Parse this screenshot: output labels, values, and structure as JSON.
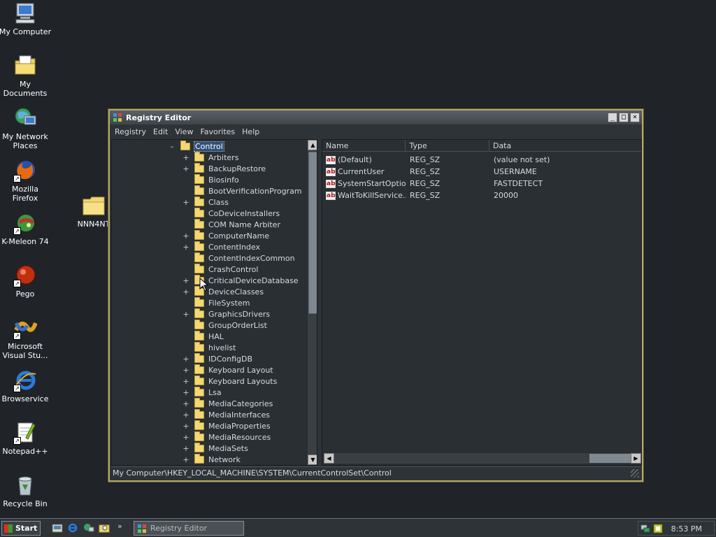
{
  "desktop": {
    "icons": [
      {
        "name": "my-computer",
        "label": "My Computer"
      },
      {
        "name": "my-documents",
        "label": "My Documents"
      },
      {
        "name": "my-network-places",
        "label": "My Network Places"
      },
      {
        "name": "mozilla-firefox",
        "label": "Mozilla Firefox"
      },
      {
        "name": "k-meleon",
        "label": "K-Meleon 74"
      },
      {
        "name": "pego",
        "label": "Pego"
      },
      {
        "name": "visual-studio",
        "label": "Microsoft Visual Stu..."
      },
      {
        "name": "browservice",
        "label": "Browservice"
      },
      {
        "name": "notepad-plus-plus",
        "label": "Notepad++"
      },
      {
        "name": "recycle-bin",
        "label": "Recycle Bin"
      },
      {
        "name": "nnn4nt",
        "label": "NNN4NT"
      }
    ]
  },
  "window": {
    "title": "Registry Editor",
    "menu": [
      "Registry",
      "Edit",
      "View",
      "Favorites",
      "Help"
    ],
    "tree": {
      "root": {
        "label": "Control",
        "expander": "–"
      },
      "items": [
        {
          "label": "Arbiters",
          "expander": "+"
        },
        {
          "label": "BackupRestore",
          "expander": "+"
        },
        {
          "label": "Biosinfo",
          "expander": ""
        },
        {
          "label": "BootVerificationProgram",
          "expander": ""
        },
        {
          "label": "Class",
          "expander": "+"
        },
        {
          "label": "CoDeviceInstallers",
          "expander": ""
        },
        {
          "label": "COM Name Arbiter",
          "expander": ""
        },
        {
          "label": "ComputerName",
          "expander": "+"
        },
        {
          "label": "ContentIndex",
          "expander": "+"
        },
        {
          "label": "ContentIndexCommon",
          "expander": ""
        },
        {
          "label": "CrashControl",
          "expander": ""
        },
        {
          "label": "CriticalDeviceDatabase",
          "expander": "+"
        },
        {
          "label": "DeviceClasses",
          "expander": "+"
        },
        {
          "label": "FileSystem",
          "expander": ""
        },
        {
          "label": "GraphicsDrivers",
          "expander": "+"
        },
        {
          "label": "GroupOrderList",
          "expander": ""
        },
        {
          "label": "HAL",
          "expander": ""
        },
        {
          "label": "hivelist",
          "expander": ""
        },
        {
          "label": "IDConfigDB",
          "expander": "+"
        },
        {
          "label": "Keyboard Layout",
          "expander": "+"
        },
        {
          "label": "Keyboard Layouts",
          "expander": "+"
        },
        {
          "label": "Lsa",
          "expander": "+"
        },
        {
          "label": "MediaCategories",
          "expander": "+"
        },
        {
          "label": "MediaInterfaces",
          "expander": "+"
        },
        {
          "label": "MediaProperties",
          "expander": "+"
        },
        {
          "label": "MediaResources",
          "expander": "+"
        },
        {
          "label": "MediaSets",
          "expander": "+"
        },
        {
          "label": "Network",
          "expander": "+"
        }
      ]
    },
    "list": {
      "columns": [
        "Name",
        "Type",
        "Data"
      ],
      "rows": [
        {
          "name": "(Default)",
          "type": "REG_SZ",
          "data": "(value not set)"
        },
        {
          "name": "CurrentUser",
          "type": "REG_SZ",
          "data": "USERNAME"
        },
        {
          "name": "SystemStartOptions",
          "type": "REG_SZ",
          "data": "FASTDETECT"
        },
        {
          "name": "WaitToKillService...",
          "type": "REG_SZ",
          "data": "20000"
        }
      ],
      "value_icon_text": "ab"
    },
    "status": "My Computer\\HKEY_LOCAL_MACHINE\\SYSTEM\\CurrentControlSet\\Control"
  },
  "taskbar": {
    "start_label": "Start",
    "tasks": [
      {
        "label": "Registry Editor"
      }
    ],
    "quicklaunch_overflow": "»",
    "clock": "8:53 PM"
  },
  "colors": {
    "desktop": "#202428",
    "window_border": "#b8a866",
    "folder": "#f2d774",
    "selection": "#2f4f7a"
  }
}
